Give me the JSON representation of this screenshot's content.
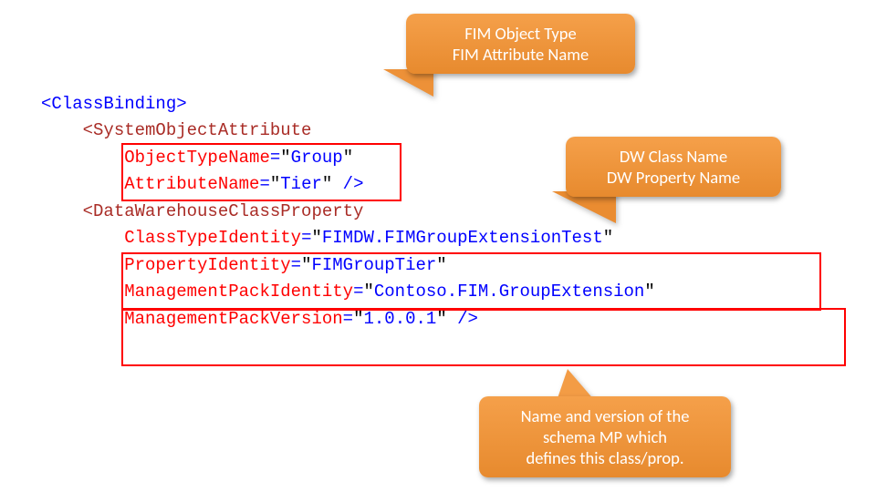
{
  "xml": {
    "open": "<ClassBinding>",
    "soa": "<SystemObjectAttribute",
    "l1a": "ObjectTypeName",
    "l1v": "Group",
    "l2a": "AttributeName",
    "l2v": "Tier",
    "dwcp": "<DataWarehouseClassProperty",
    "l3a": "ClassTypeIdentity",
    "l3v": "FIMDW.FIMGroupExtensionTest",
    "l4a": "PropertyIdentity",
    "l4v": "FIMGroupTier",
    "l5a": "ManagementPackIdentity",
    "l5v": "Contoso.FIM.GroupExtension",
    "l6a": "ManagementPackVersion",
    "l6v": "1.0.0.1",
    "eq": "=",
    "q": "\"",
    "close": " />"
  },
  "callouts": {
    "c1a": "FIM Object Type",
    "c1b": "FIM Attribute Name",
    "c2a": "DW Class Name",
    "c2b": "DW Property Name",
    "c3a": "Name and version of the",
    "c3b": "schema MP which",
    "c3c": "defines this class/prop."
  }
}
